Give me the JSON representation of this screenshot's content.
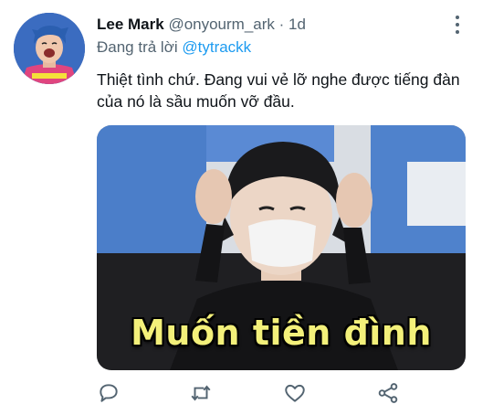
{
  "tweet": {
    "author_name": "Lee Mark",
    "author_handle": "@onyourm_ark",
    "separator": "·",
    "time": "1d",
    "reply_prefix": "Đang trả lời ",
    "reply_mention": "@tytrackk",
    "text": "Thiệt tình chứ. Đang vui vẻ lỡ nghe được tiếng đàn của nó là sầu muốn vỡ đầu.",
    "media": {
      "caption": "Muốn tiền đình"
    }
  },
  "actions": {
    "reply_icon": "reply-icon",
    "retweet_icon": "retweet-icon",
    "like_icon": "heart-icon",
    "share_icon": "share-icon"
  },
  "colors": {
    "accent": "#1d9bf0",
    "secondary_text": "#536471",
    "caption": "#f3f07a"
  }
}
